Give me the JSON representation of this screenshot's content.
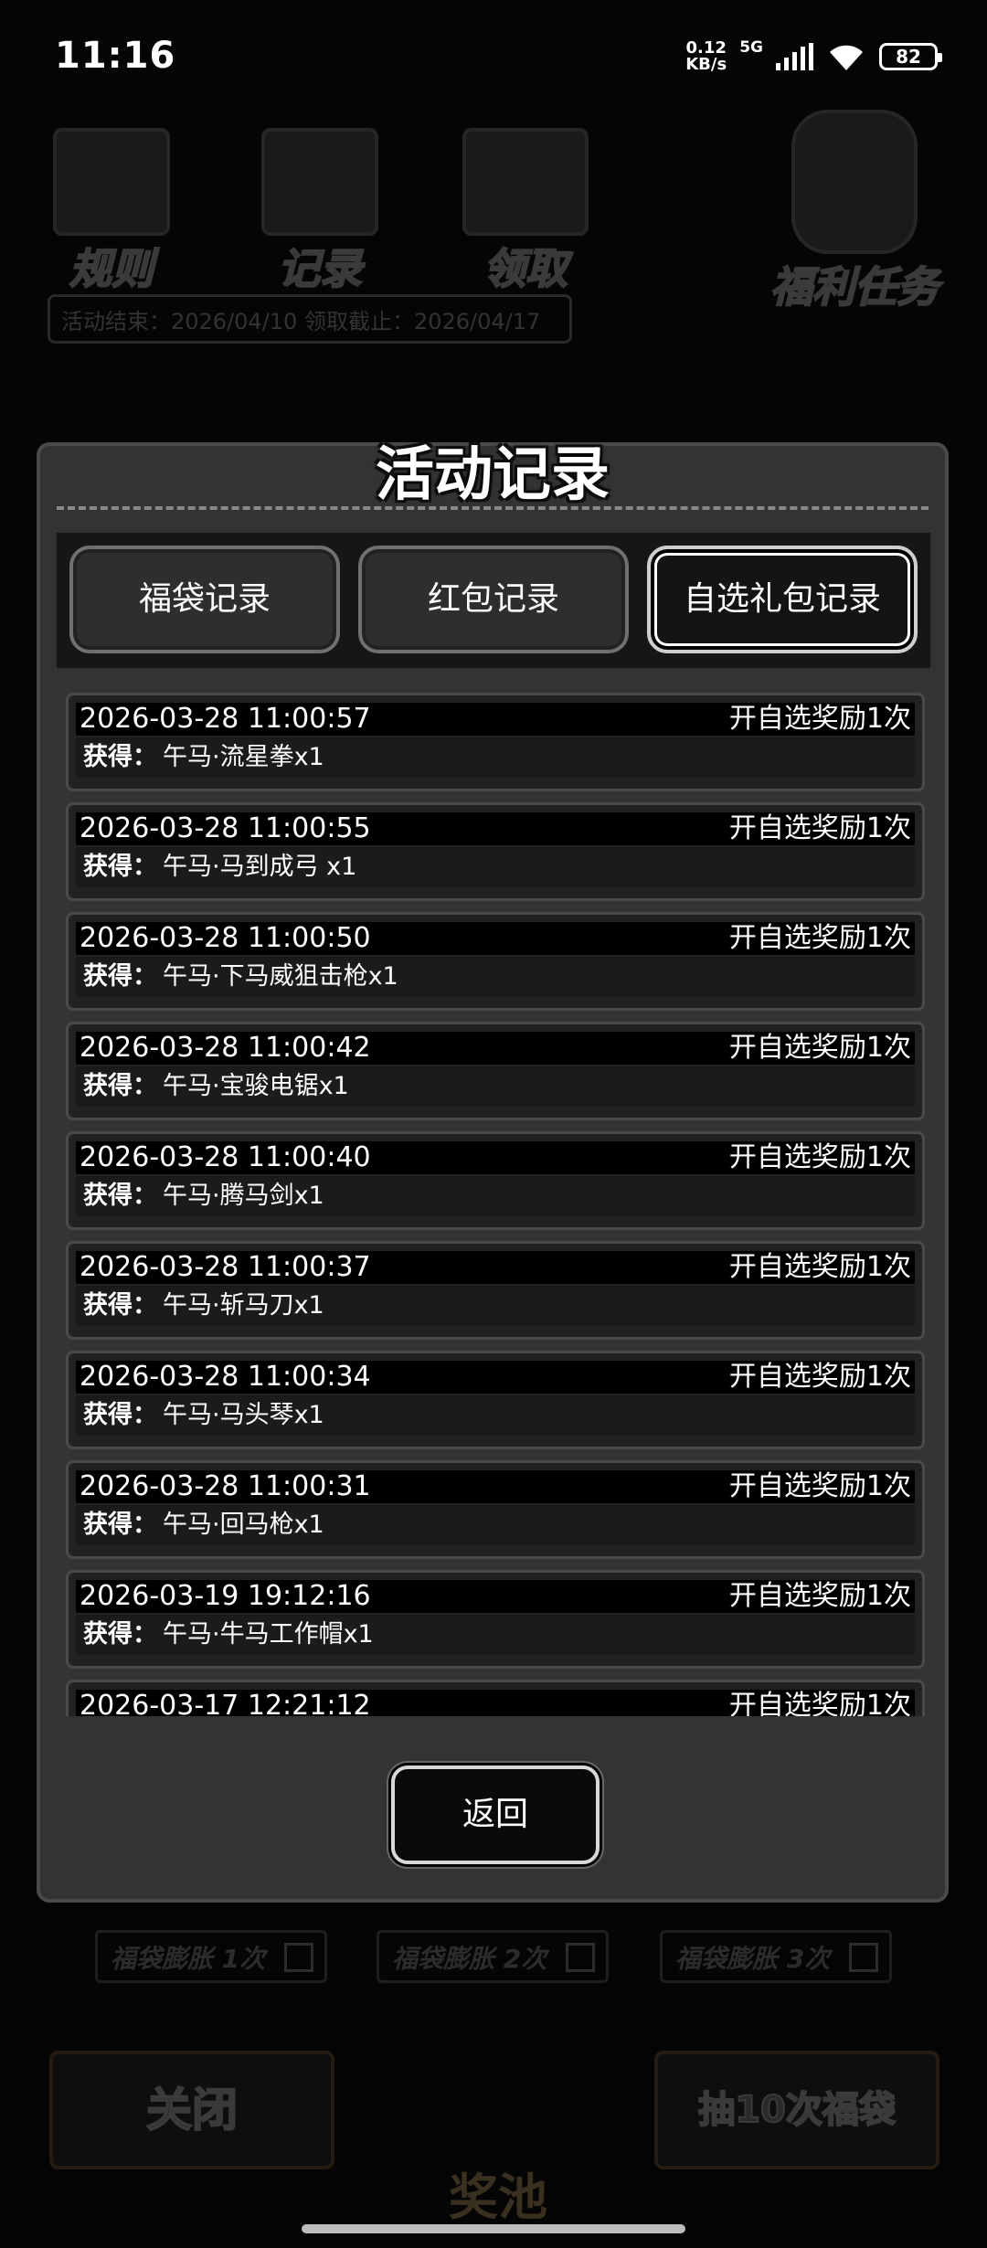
{
  "status_bar": {
    "time": "11:16",
    "speed_value": "0.12",
    "speed_unit": "KB/s",
    "network": "5G",
    "battery": "82"
  },
  "background": {
    "icons": [
      {
        "label": "规则"
      },
      {
        "label": "记录"
      },
      {
        "label": "领取"
      },
      {
        "label": "福利任务"
      }
    ],
    "deadline": "活动结束：2026/04/10   领取截止：2026/04/17",
    "expand_options": [
      "福袋膨胀 1次",
      "福袋膨胀 2次",
      "福袋膨胀 3次"
    ],
    "close_button": "关闭",
    "pool_label": "奖池",
    "draw_button": "抽10次福袋"
  },
  "dialog": {
    "title": "活动记录",
    "tabs": [
      {
        "label": "福袋记录",
        "active": false
      },
      {
        "label": "红包记录",
        "active": false
      },
      {
        "label": "自选礼包记录",
        "active": true
      }
    ],
    "records": [
      {
        "date": "2026-03-28 11:00:57",
        "type": "开自选奖励1次",
        "prefix": "获得：",
        "item": "午马·流星拳x1"
      },
      {
        "date": "2026-03-28 11:00:55",
        "type": "开自选奖励1次",
        "prefix": "获得：",
        "item": "午马·马到成弓 x1"
      },
      {
        "date": "2026-03-28 11:00:50",
        "type": "开自选奖励1次",
        "prefix": "获得：",
        "item": "午马·下马威狙击枪x1"
      },
      {
        "date": "2026-03-28 11:00:42",
        "type": "开自选奖励1次",
        "prefix": "获得：",
        "item": "午马·宝骏电锯x1"
      },
      {
        "date": "2026-03-28 11:00:40",
        "type": "开自选奖励1次",
        "prefix": "获得：",
        "item": "午马·腾马剑x1"
      },
      {
        "date": "2026-03-28 11:00:37",
        "type": "开自选奖励1次",
        "prefix": "获得：",
        "item": "午马·斩马刀x1"
      },
      {
        "date": "2026-03-28 11:00:34",
        "type": "开自选奖励1次",
        "prefix": "获得：",
        "item": "午马·马头琴x1"
      },
      {
        "date": "2026-03-28 11:00:31",
        "type": "开自选奖励1次",
        "prefix": "获得：",
        "item": "午马·回马枪x1"
      },
      {
        "date": "2026-03-19 19:12:16",
        "type": "开自选奖励1次",
        "prefix": "获得：",
        "item": "午马·牛马工作帽x1"
      },
      {
        "date": "2026-03-17 12:21:12",
        "type": "开自选奖励1次",
        "prefix": "",
        "item": ""
      }
    ],
    "back_button": "返回"
  }
}
